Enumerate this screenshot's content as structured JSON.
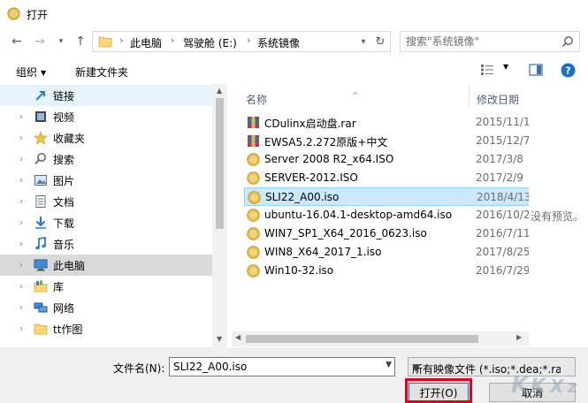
{
  "window": {
    "title": "打开"
  },
  "address": {
    "crumbs": [
      "此电脑",
      "驾驶舱 (E:)",
      "系统镜像"
    ],
    "search_placeholder": "搜索\"系统镜像\""
  },
  "toolbar": {
    "organize": "组织",
    "new_folder": "新建文件夹"
  },
  "nav": {
    "items": [
      {
        "label": "链接",
        "icon": "link-icon",
        "chevron": false,
        "state": "hover"
      },
      {
        "label": "视频",
        "icon": "video-icon",
        "chevron": true,
        "state": ""
      },
      {
        "label": "收藏夹",
        "icon": "star-icon",
        "chevron": true,
        "state": ""
      },
      {
        "label": "搜索",
        "icon": "search-icon",
        "chevron": true,
        "state": ""
      },
      {
        "label": "图片",
        "icon": "picture-icon",
        "chevron": true,
        "state": ""
      },
      {
        "label": "文档",
        "icon": "document-icon",
        "chevron": true,
        "state": ""
      },
      {
        "label": "下载",
        "icon": "download-icon",
        "chevron": true,
        "state": ""
      },
      {
        "label": "音乐",
        "icon": "music-icon",
        "chevron": true,
        "state": ""
      },
      {
        "label": "此电脑",
        "icon": "computer-icon",
        "chevron": true,
        "state": "selected"
      },
      {
        "label": "库",
        "icon": "library-icon",
        "chevron": true,
        "state": ""
      },
      {
        "label": "网络",
        "icon": "network-icon",
        "chevron": true,
        "state": ""
      },
      {
        "label": "tt作图",
        "icon": "folder-icon",
        "chevron": true,
        "state": ""
      }
    ]
  },
  "columns": {
    "name": "名称",
    "modified": "修改日期"
  },
  "files": [
    {
      "name": "CDulinx启动盘.rar",
      "date": "2015/11/1",
      "type": "rar",
      "selected": false
    },
    {
      "name": "EWSA5.2.272原版+中文",
      "date": "2015/12/7",
      "type": "rar",
      "selected": false
    },
    {
      "name": "Server 2008 R2_x64.ISO",
      "date": "2017/3/8",
      "type": "iso",
      "selected": false
    },
    {
      "name": "SERVER-2012.ISO",
      "date": "2017/2/9",
      "type": "iso",
      "selected": false
    },
    {
      "name": "SLI22_A00.iso",
      "date": "2018/4/13",
      "type": "iso",
      "selected": true
    },
    {
      "name": "ubuntu-16.04.1-desktop-amd64.iso",
      "date": "2016/10/2",
      "type": "iso",
      "selected": false
    },
    {
      "name": "WIN7_SP1_X64_2016_0623.iso",
      "date": "2016/7/11",
      "type": "iso",
      "selected": false
    },
    {
      "name": "WIN8_X64_2017_1.iso",
      "date": "2017/8/25",
      "type": "iso",
      "selected": false
    },
    {
      "name": "Win10-32.iso",
      "date": "2016/7/29",
      "type": "iso",
      "selected": false
    }
  ],
  "preview": {
    "empty_text": "没有预览。"
  },
  "bottom": {
    "filename_label": "文件名(N):",
    "filename_value": "SLI22_A00.iso",
    "filetype_value": "所有映像文件 (*.iso;*.dea;*.rar",
    "open_label": "打开(O)",
    "cancel_label": "取消"
  },
  "colors": {
    "selected_row": "#cce8ff",
    "accent": "#0078d7",
    "highlight_box": "#e3001b"
  }
}
